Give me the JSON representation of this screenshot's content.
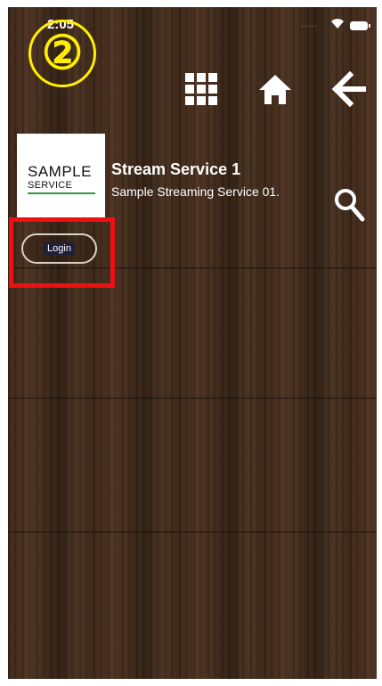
{
  "status_bar": {
    "time": "2:05",
    "signal": "....."
  },
  "step_marker": "②",
  "nav": {
    "grid_icon": "grid-icon",
    "home_icon": "home-icon",
    "back_icon": "arrow-left-icon"
  },
  "service": {
    "logo_line1": "SAMPLE",
    "logo_line2": "SERVICE",
    "title": "Stream Service 1",
    "description": "Sample Streaming Service 01."
  },
  "search_icon": "search-icon",
  "login": {
    "label": "Login"
  },
  "colors": {
    "marker": "#ffee00",
    "highlight": "#ee1111",
    "logo_accent": "#2e9a3c",
    "wood_dark": "#2b1b10",
    "wood_light": "#4b3020"
  }
}
